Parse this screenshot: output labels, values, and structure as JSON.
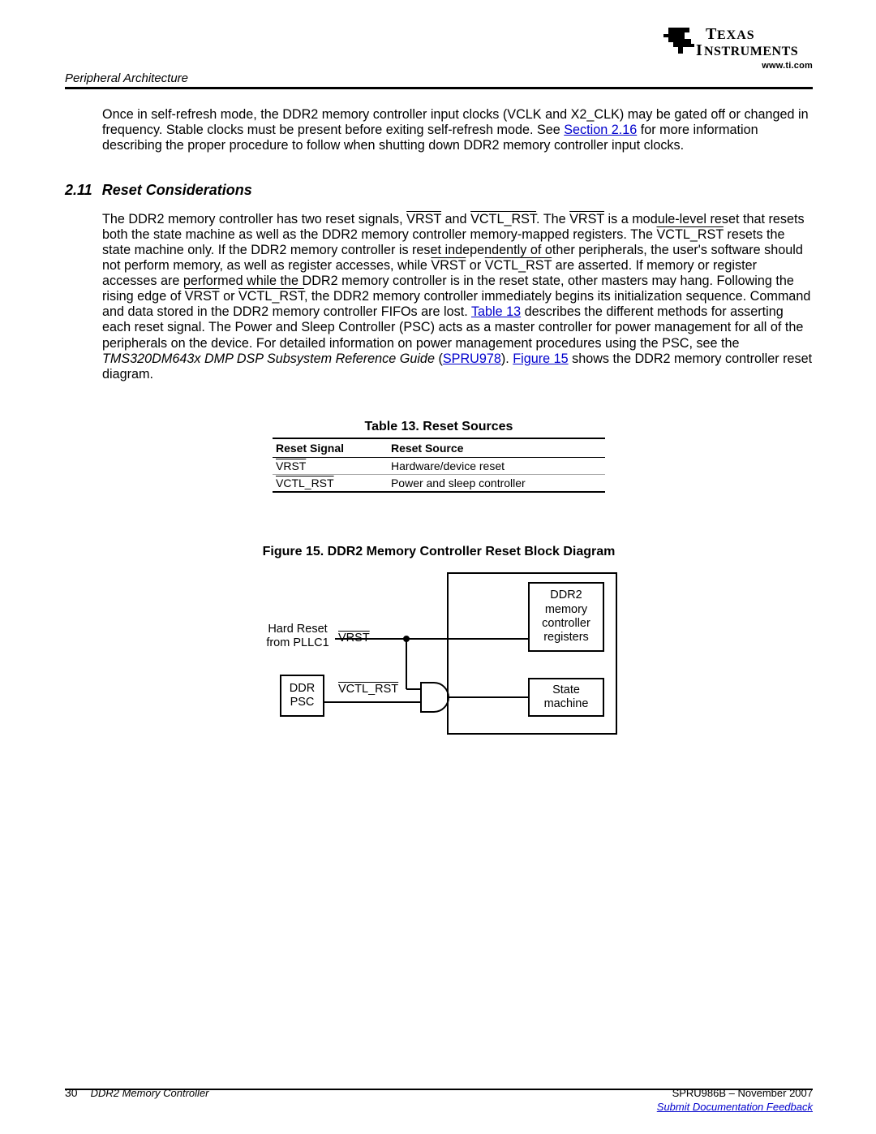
{
  "logo": {
    "url_text": "www.ti.com"
  },
  "header": {
    "section_label": "Peripheral Architecture"
  },
  "intro_para": {
    "t1": "Once in self-refresh mode, the DDR2 memory controller input clocks (VCLK and X2_CLK) may be gated off or changed in frequency. Stable clocks must be present before exiting self-refresh mode. See ",
    "link": "Section 2.16",
    "t2": " for more information describing the proper procedure to follow when shutting down DDR2 memory controller input clocks."
  },
  "section": {
    "number": "2.11",
    "title": "Reset Considerations"
  },
  "reset_para": {
    "t1": "The DDR2 memory controller has two reset signals, ",
    "s_vrst": "VRST",
    "t2": " and ",
    "s_vctl": "VCTL_RST",
    "t3": ". The ",
    "t4": " is a module-level reset that resets both the state machine as well as the DDR2 memory controller memory-mapped registers. The ",
    "t5": " resets the state machine only. If the DDR2 memory controller is reset independently of other peripherals, the user's software should not perform memory, as well as register accesses, while ",
    "t6": " or ",
    "t7": " are asserted. If memory or register accesses are performed while the DDR2 memory controller is in the reset state, other masters may hang. Following the rising edge of ",
    "t8": ", the DDR2 memory controller immediately begins its initialization sequence. Command and data stored in the DDR2 memory controller FIFOs are lost. ",
    "link_tbl": "Table 13",
    "t9": " describes the different methods for asserting each reset signal. The Power and Sleep Controller (PSC) acts as a master controller for power management for all of the peripherals on the device. For detailed information on power management procedures using the PSC, see the ",
    "ital": "TMS320DM643x DMP DSP Subsystem Reference Guide",
    "t10": " (",
    "link_spru": "SPRU978",
    "t11": "). ",
    "link_fig": "Figure 15",
    "t12": " shows the DDR2 memory controller reset diagram."
  },
  "table": {
    "caption": "Table 13. Reset Sources",
    "head": {
      "c1": "Reset Signal",
      "c2": "Reset Source"
    },
    "rows": [
      {
        "c1": "VRST",
        "c2": "Hardware/device reset"
      },
      {
        "c1": "VCTL_RST",
        "c2": "Power and sleep controller"
      }
    ]
  },
  "figure": {
    "caption": "Figure 15. DDR2 Memory Controller Reset Block Diagram",
    "labels": {
      "hard_reset": "Hard Reset from PLLC1",
      "ddr_psc": "DDR PSC",
      "vrst": "VRST",
      "vctl_rst": "VCTL_RST",
      "regs": "DDR2 memory controller registers",
      "sm": "State machine"
    }
  },
  "footer": {
    "page": "30",
    "title": "DDR2 Memory Controller",
    "docid": "SPRU986B – November 2007",
    "feedback": "Submit Documentation Feedback"
  }
}
